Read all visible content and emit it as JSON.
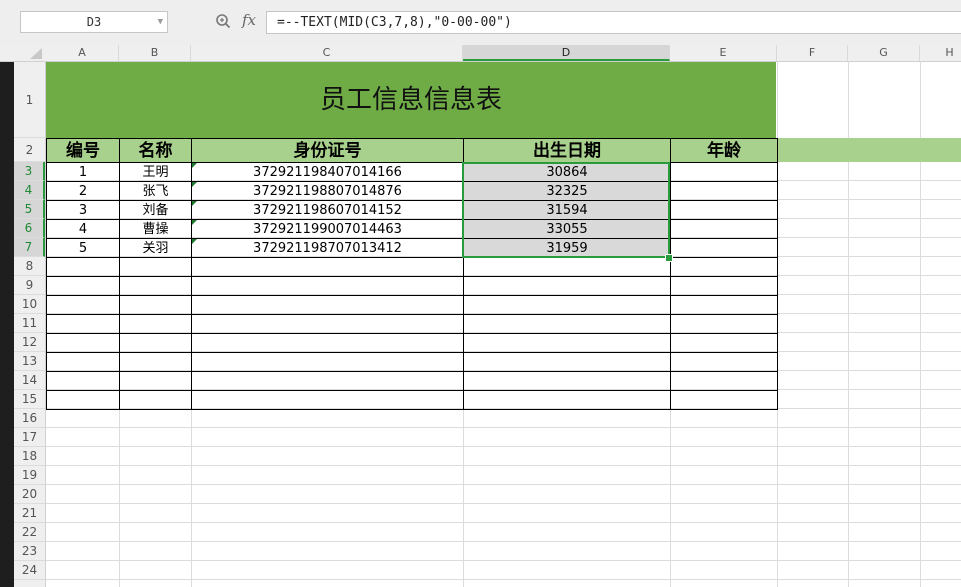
{
  "formula_bar": {
    "name_box": "D3",
    "fx_label": "fx",
    "formula": "=--TEXT(MID(C3,7,8),\"0-00-00\")"
  },
  "columns": [
    "A",
    "B",
    "C",
    "D",
    "E",
    "F",
    "G",
    "H"
  ],
  "rows": [
    "1",
    "2",
    "3",
    "4",
    "5",
    "6",
    "7",
    "8",
    "9",
    "10",
    "11",
    "12",
    "13",
    "14",
    "15",
    "16",
    "17",
    "18",
    "19",
    "20",
    "21",
    "22",
    "23",
    "24"
  ],
  "sheet": {
    "title": "员工信息信息表",
    "headers": [
      "编号",
      "名称",
      "身份证号",
      "出生日期",
      "年龄"
    ],
    "records": [
      {
        "no": "1",
        "name": "王明",
        "id": "372921198407014166",
        "birth": "30864",
        "age": ""
      },
      {
        "no": "2",
        "name": "张飞",
        "id": "372921198807014876",
        "birth": "32325",
        "age": ""
      },
      {
        "no": "3",
        "name": "刘备",
        "id": "372921198607014152",
        "birth": "31594",
        "age": ""
      },
      {
        "no": "4",
        "name": "曹操",
        "id": "372921199007014463",
        "birth": "33055",
        "age": ""
      },
      {
        "no": "5",
        "name": "关羽",
        "id": "372921198707013412",
        "birth": "31959",
        "age": ""
      }
    ],
    "empty_rows": 8
  },
  "colors": {
    "title_fill": "#6fac46",
    "header_fill": "#a9d18e",
    "selection": "#2a9a3e"
  }
}
